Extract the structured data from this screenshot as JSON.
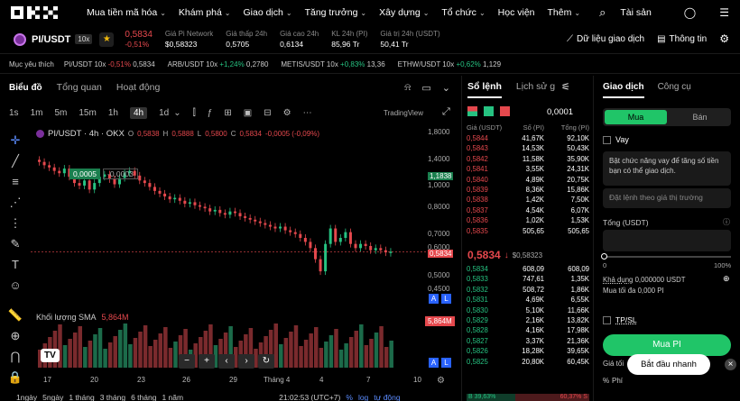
{
  "nav": {
    "items": [
      "Mua tiền mã hóa",
      "Khám phá",
      "Giao dịch",
      "Tăng trưởng",
      "Xây dựng",
      "Tổ chức",
      "Học viện",
      "Thêm"
    ],
    "assets_label": "Tài sản"
  },
  "ticker": {
    "pair": "PI/USDT",
    "leverage": "10x",
    "price": "0,5834",
    "change": "-0,51%",
    "stats": [
      {
        "label": "Giá Pi Network",
        "value": "$0,58323"
      },
      {
        "label": "Giá thấp 24h",
        "value": "0,5705"
      },
      {
        "label": "Giá cao 24h",
        "value": "0,6134"
      },
      {
        "label": "KL 24h (PI)",
        "value": "85,96 Tr"
      },
      {
        "label": "Giá trị 24h (USDT)",
        "value": "50,41 Tr"
      }
    ],
    "data_btn": "Dữ liệu giao dịch",
    "info_btn": "Thông tin"
  },
  "watchlist": {
    "label": "Mục yêu thích",
    "items": [
      {
        "pair": "PI/USDT 10x",
        "change": "-0,51%",
        "price": "0,5834",
        "dir": "down"
      },
      {
        "pair": "ARB/USDT 10x",
        "change": "+1,24%",
        "price": "0,2780",
        "dir": "up"
      },
      {
        "pair": "METIS/USDT 10x",
        "change": "+0,83%",
        "price": "13,36",
        "dir": "up"
      },
      {
        "pair": "ETHW/USDT 10x",
        "change": "+0,62%",
        "price": "1,129",
        "dir": "up"
      }
    ]
  },
  "chart_tabs": [
    "Biểu đồ",
    "Tổng quan",
    "Hoạt động"
  ],
  "timeframes": [
    "1s",
    "1m",
    "5m",
    "15m",
    "1h",
    "4h",
    "1d"
  ],
  "tradingview_label": "TradingView",
  "legend": {
    "title": "PI/USDT · 4h · OKX",
    "o": "0,5838",
    "h": "0,5888",
    "l": "0,5800",
    "c": "0,5834",
    "chg": "-0,0005 (-0,09%)",
    "bid": "0,0005",
    "spread": "-0,0003"
  },
  "volume": {
    "label": "Khối lượng SMA",
    "value": "5,864M",
    "tag": "5,864M"
  },
  "chart_data": {
    "type": "candlestick",
    "yticks": [
      "1,8000",
      "1,4000",
      "1,1838",
      "1,0000",
      "0,8000",
      "0,7000",
      "0,6000",
      "0,5834",
      "0,5000",
      "0,4500"
    ],
    "xticks": [
      "17",
      "20",
      "23",
      "26",
      "29",
      "Tháng 4",
      "4",
      "7",
      "10"
    ],
    "close_values": [
      1.18,
      1.15,
      1.13,
      1.1,
      1.08,
      1.12,
      1.05,
      1.0,
      0.98,
      1.02,
      0.95,
      1.0,
      1.05,
      1.07,
      1.03,
      0.99,
      1.04,
      1.08,
      1.1,
      1.06,
      1.02,
      1.0,
      0.97,
      0.94,
      0.92,
      0.9,
      0.88,
      0.89,
      0.87,
      0.85,
      0.86,
      0.84,
      0.83,
      0.82,
      0.8,
      0.81,
      0.79,
      0.78,
      0.8,
      0.79,
      0.77,
      0.76,
      0.75,
      0.74,
      0.73,
      0.72,
      0.71,
      0.7,
      0.71,
      0.69,
      0.68,
      0.67,
      0.65,
      0.63,
      0.6,
      0.55,
      0.5,
      0.62,
      0.7,
      0.63,
      0.65,
      0.68,
      0.62,
      0.6,
      0.62,
      0.61,
      0.59,
      0.6,
      0.59,
      0.58,
      0.5834
    ]
  },
  "bottom_bar": {
    "ranges": [
      "1ngày",
      "5ngày",
      "1 tháng",
      "3 tháng",
      "6 tháng",
      "1 năm"
    ],
    "time": "21:02:53 (UTC+7)",
    "pct": "%",
    "log": "log",
    "auto": "tự động"
  },
  "orderbook": {
    "tabs": [
      "Sổ lệnh",
      "Lịch sử g"
    ],
    "headers": [
      "Giá (USDT)",
      "Số (PI)",
      "Tổng (PI)"
    ],
    "tick": "0,0001",
    "asks": [
      [
        "0,5844",
        "41,67K",
        "92,10K"
      ],
      [
        "0,5843",
        "14,53K",
        "50,43K"
      ],
      [
        "0,5842",
        "11,58K",
        "35,90K"
      ],
      [
        "0,5841",
        "3,55K",
        "24,31K"
      ],
      [
        "0,5840",
        "4,89K",
        "20,75K"
      ],
      [
        "0,5839",
        "8,36K",
        "15,86K"
      ],
      [
        "0,5838",
        "1,42K",
        "7,50K"
      ],
      [
        "0,5837",
        "4,54K",
        "6,07K"
      ],
      [
        "0,5836",
        "1,02K",
        "1,53K"
      ],
      [
        "0,5835",
        "505,65",
        "505,65"
      ]
    ],
    "mid_price": "0,5834",
    "mid_usd": "$0,58323",
    "bids": [
      [
        "0,5834",
        "608,09",
        "608,09"
      ],
      [
        "0,5833",
        "747,61",
        "1,35K"
      ],
      [
        "0,5832",
        "508,72",
        "1,86K"
      ],
      [
        "0,5831",
        "4,69K",
        "6,55K"
      ],
      [
        "0,5830",
        "5,10K",
        "11,66K"
      ],
      [
        "0,5829",
        "2,16K",
        "13,82K"
      ],
      [
        "0,5828",
        "4,16K",
        "17,98K"
      ],
      [
        "0,5827",
        "3,37K",
        "21,36K"
      ],
      [
        "0,5826",
        "18,28K",
        "39,65K"
      ],
      [
        "0,5825",
        "20,80K",
        "60,45K"
      ]
    ],
    "buy_pct": "B 39,63%",
    "sell_pct": "60,37% S"
  },
  "trade": {
    "tabs": [
      "Giao dịch",
      "Công cụ"
    ],
    "buy": "Mua",
    "sell": "Bán",
    "borrow": "Vay",
    "borrow_note": "Bật chức năng vay để tăng số tiền bạn có thể giao dịch.",
    "price_placeholder": "Đặt lệnh theo giá thị trường",
    "total_label": "Tổng (USDT)",
    "pct0": "0",
    "pct100": "100%",
    "avail_label": "Khả dụng",
    "avail_value": "0,000000 USDT",
    "max_label": "Mua tối đa",
    "max_value": "0,000 PI",
    "tpsl": "TP/SL",
    "buy_btn": "Mua PI",
    "fee_label": "Giá tối",
    "fee_label2": "Phí",
    "toast": "Bắt đầu nhanh"
  },
  "colors": {
    "up": "#26c281",
    "down": "#e5484d",
    "accent": "#20c568"
  }
}
